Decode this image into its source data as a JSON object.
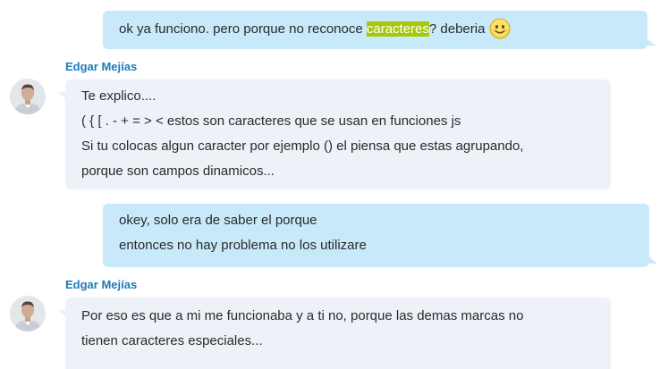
{
  "messages": [
    {
      "direction": "outgoing",
      "parts": {
        "before": "ok ya funciono. pero porque no reconoce ",
        "highlight": "caracteres",
        "after": "? deberia"
      },
      "emoji": "smiling-face-emoji"
    },
    {
      "direction": "incoming",
      "sender": "Edgar Mejías",
      "lines": [
        "Te explico....",
        "( { [ . - + = > < estos son caracteres que se usan en funciones js",
        "Si tu colocas algun caracter por ejemplo () el piensa que estas agrupando,",
        "porque son campos dinamicos..."
      ]
    },
    {
      "direction": "outgoing",
      "lines": [
        "okey, solo era de saber el porque",
        "entonces no hay problema no los utilizare"
      ]
    },
    {
      "direction": "incoming",
      "sender": "Edgar Mejías",
      "lines": [
        "Por eso es que a mi me funcionaba y a ti no, porque las demas marcas no",
        "tienen caracteres especiales..."
      ]
    }
  ],
  "colors": {
    "outgoing_bubble": "#c7e9f9",
    "incoming_bubble": "#eef1f7",
    "sender_name": "#1e7bb8",
    "search_highlight": "#a6c80e"
  },
  "icons": {
    "avatar": "user-photo-avatar",
    "emoji": "smiling-face-emoji"
  }
}
